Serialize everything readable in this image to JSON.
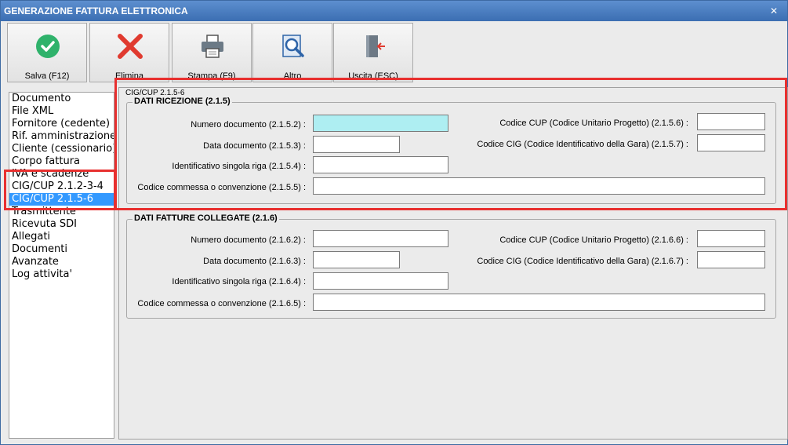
{
  "window": {
    "title": "GENERAZIONE FATTURA ELETTRONICA",
    "close_glyph": "✕"
  },
  "toolbar": {
    "save": "Salva (F12)",
    "delete": "Elimina",
    "print": "Stampa (F9)",
    "other": "Altro",
    "exit": "Uscita (ESC)"
  },
  "sidebar": {
    "items": [
      "Documento",
      "File XML",
      "Fornitore (cedente)",
      "Rif. amministrazione",
      "Cliente (cessionario)",
      "Corpo fattura",
      "IVA e scadenze",
      "CIG/CUP 2.1.2-3-4",
      "CIG/CUP 2.1.5-6",
      "Trasmittente",
      "Ricevuta SDI",
      "Allegati",
      "Documenti",
      "Avanzate",
      "Log attivita'"
    ],
    "selected": "CIG/CUP 2.1.5-6"
  },
  "panel": {
    "caption": "CIG/CUP 2.1.5-6"
  },
  "ricezione": {
    "title": "DATI RICEZIONE (2.1.5)",
    "numero_label": "Numero documento (2.1.5.2) :",
    "numero_value": "",
    "data_label": "Data documento (2.1.5.3) :",
    "data_value": "",
    "riga_label": "Identificativo singola riga (2.1.5.4) :",
    "riga_value": "",
    "commessa_label": "Codice commessa o convenzione (2.1.5.5) :",
    "commessa_value": "",
    "cup_label": "Codice CUP (Codice Unitario Progetto) (2.1.5.6) :",
    "cup_value": "",
    "cig_label": "Codice CIG (Codice Identificativo della Gara) (2.1.5.7) :",
    "cig_value": ""
  },
  "collegate": {
    "title": "DATI FATTURE COLLEGATE (2.1.6)",
    "numero_label": "Numero documento (2.1.6.2) :",
    "numero_value": "",
    "data_label": "Data documento (2.1.6.3) :",
    "data_value": "",
    "riga_label": "Identificativo singola riga (2.1.6.4) :",
    "riga_value": "",
    "commessa_label": "Codice commessa o convenzione (2.1.6.5) :",
    "commessa_value": "",
    "cup_label": "Codice CUP (Codice Unitario Progetto) (2.1.6.6) :",
    "cup_value": "",
    "cig_label": "Codice CIG (Codice Identificativo della Gara) (2.1.6.7) :",
    "cig_value": ""
  },
  "colors": {
    "highlight": "#e8302f",
    "selection": "#3399ff",
    "focus_field": "#aeeef2",
    "titlebar": "#3b6eb2"
  },
  "icons": [
    "check-icon",
    "delete-x-icon",
    "printer-icon",
    "search-icon",
    "exit-door-icon"
  ]
}
